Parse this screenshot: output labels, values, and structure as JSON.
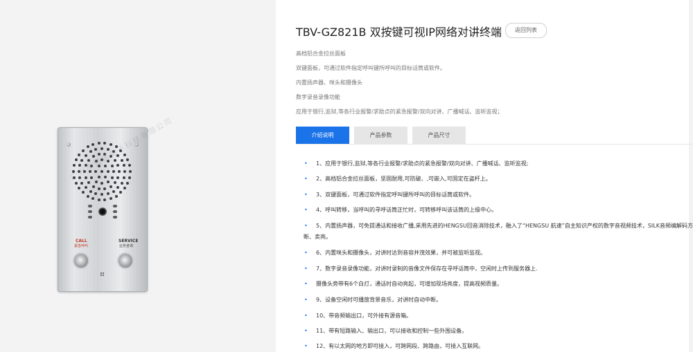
{
  "product": {
    "title": "TBV-GZ821B 双按键可视IP网络对讲终端",
    "back_label": "返回列表",
    "features": [
      "高档铝合金拉丝面板",
      "双键面板，可通过软件指定呼叫键所呼叫的目标话筒或软件。",
      "内置扬声器、咪头和摄像头",
      "数字录音录像功能",
      "应用于银行,监狱,等各行业报警/求助点的紧急报警/双向对讲、广播喊话、监听监视；"
    ]
  },
  "device": {
    "call_label": "CALL",
    "call_sub": "紧急呼叫",
    "service_label": "SERVICE",
    "service_sub": "业务咨询",
    "watermark": "广州市恒速电子科技有限公司"
  },
  "tabs": [
    {
      "label": "介绍说明",
      "active": true
    },
    {
      "label": "产品参数",
      "active": false
    },
    {
      "label": "产品尺寸",
      "active": false
    }
  ],
  "details": [
    "1、应用于银行,监狱,等各行业报警/求助点的紧急报警/双向对讲、广播喊话、监听监视;",
    "2、高档铝合金拉丝面板，坚固耐用,可防破、,可嵌入,可固定在盗杆上。",
    "3、双键面板，可通过软件指定呼叫键所呼叫的目标话筒或软件。",
    "4、呼叫转移，当呼叫的寻呼话筒正忙时，可转移呼叫该话筒的上级中心。",
    "5、内置扬声器，可免提通话和接收广播,采用先进的HENGSU回音消除技术，融入了“HENGSU 航速”自主知识产权的数字音视频技术，SILK音频编解码方式，",
    "断、卖亮。",
    "6、内置咪头和摄像头，对讲时达到音容并茂效果，并可被监听监视。",
    "7、数字录音录像功能，对讲时录制的音像文件保存在寻呼话筒中，空闲时上传到服务器上.",
    "摄像头旁带有6个白灯，通话时自动亮起，可增加现场亮度，提高视频质量。",
    "9、设备空闲时可播放背景音乐，对讲时自动中断。",
    "10、带音频输出口，可外接有源音箱。",
    "11、带有短路输入、输出口，可以接收和控制一些外围设备。",
    "12、有以太网的地方即可接入，可跨网段、跨路由，可接入互联网。"
  ]
}
